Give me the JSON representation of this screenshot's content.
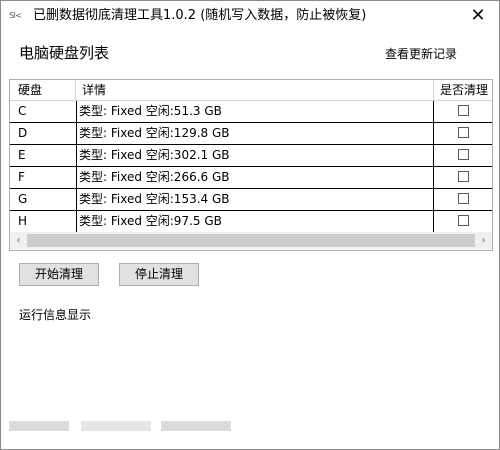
{
  "window": {
    "title": "已删数据彻底清理工具1.0.2 (随机写入数据，防止被恢复)",
    "app_icon_text": "Sl<",
    "close_glyph": "✕"
  },
  "main": {
    "heading": "电脑硬盘列表",
    "changelog_link": "查看更新记录"
  },
  "disk_list": {
    "columns": [
      "硬盘",
      "详情",
      "是否清理"
    ],
    "rows": [
      {
        "drive": "C",
        "detail": "类型: Fixed 空闲:51.3 GB",
        "checked": false
      },
      {
        "drive": "D",
        "detail": "类型: Fixed 空闲:129.8 GB",
        "checked": false
      },
      {
        "drive": "E",
        "detail": "类型: Fixed 空闲:302.1 GB",
        "checked": false
      },
      {
        "drive": "F",
        "detail": "类型: Fixed 空闲:266.6 GB",
        "checked": false
      },
      {
        "drive": "G",
        "detail": "类型: Fixed 空闲:153.4 GB",
        "checked": false
      },
      {
        "drive": "H",
        "detail": "类型: Fixed 空闲:97.5 GB",
        "checked": false
      }
    ],
    "scroll_left_glyph": "‹",
    "scroll_right_glyph": "›"
  },
  "actions": {
    "start_label": "开始清理",
    "stop_label": "停止清理"
  },
  "status": {
    "info_text": "运行信息显示"
  }
}
